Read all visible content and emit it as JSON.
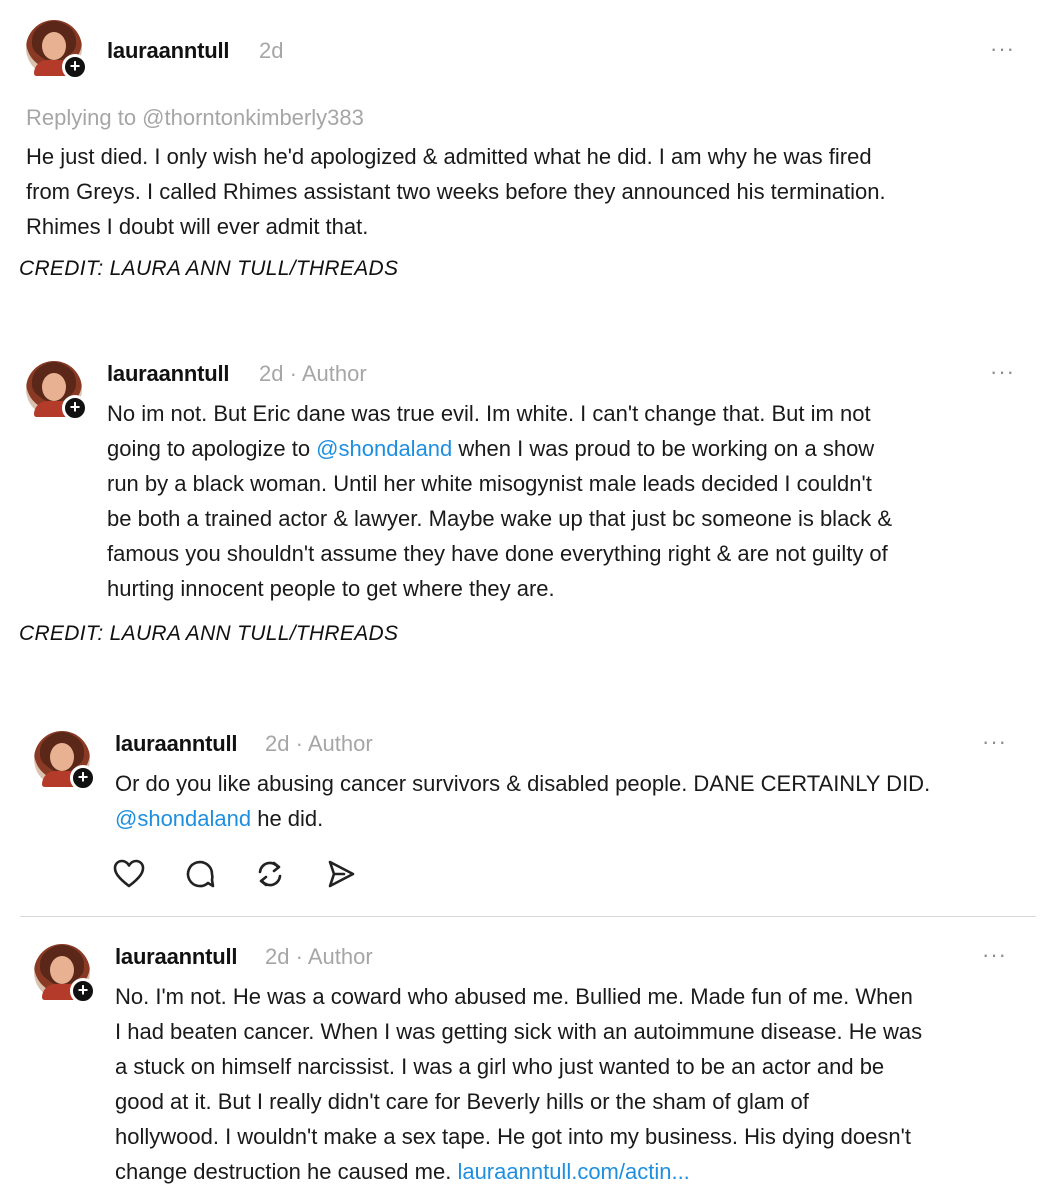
{
  "posts": [
    {
      "username": "lauraanntull",
      "time": "2d",
      "author_tag": "",
      "more": "···",
      "replying_to": "Replying to @thorntonkimberly383",
      "lines": [
        "He just died. I only wish he'd apologized & admitted what he did. I am why he was fired",
        "from Greys. I called Rhimes assistant two weeks before they announced his termination.",
        "Rhimes I doubt will ever admit that."
      ],
      "credit": "CREDIT: LAURA ANN TULL/THREADS"
    },
    {
      "username": "lauraanntull",
      "time": "2d",
      "author_tag": "· Author",
      "more": "···",
      "line1": "No im not. But Eric dane was true evil. Im white. I can't change that. But im not",
      "line2_pre": "going to apologize to ",
      "line2_mention": "@shondaland",
      "line2_post": " when I was proud to be working on a show",
      "lines_rest": [
        "run by a black woman. Until her white misogynist male leads decided I couldn't",
        "be both a trained actor & lawyer. Maybe wake up that just bc someone is black &",
        "famous you shouldn't assume they have done everything right & are not guilty of",
        "hurting innocent people to get where they are."
      ],
      "credit": "CREDIT: LAURA ANN TULL/THREADS"
    },
    {
      "username": "lauraanntull",
      "time": "2d",
      "author_tag": "· Author",
      "more": "···",
      "line1": "Or do you like abusing cancer survivors & disabled people. DANE CERTAINLY DID.",
      "line2_mention": "@shondaland",
      "line2_post": " he did.",
      "actions": [
        "heart-icon",
        "comment-icon",
        "repost-icon",
        "share-icon"
      ]
    },
    {
      "username": "lauraanntull",
      "time": "2d",
      "author_tag": "· Author",
      "more": "···",
      "lines": [
        "No. I'm not. He was a coward who abused me. Bullied me. Made fun of me. When",
        "I had beaten cancer. When I was getting sick with an autoimmune disease. He was",
        "a stuck on himself narcissist. I was a girl who just wanted to be an actor and be",
        "good at it. But I really didn't care for Beverly hills or the sham of glam of",
        "hollywood. I wouldn't make a sex tape. He got into my business. His dying doesn't"
      ],
      "last_pre": "change destruction he caused me. ",
      "last_link": "lauraanntull.com/actin..."
    }
  ],
  "colors": {
    "mention": "#1e8fe0",
    "meta": "#a6a6a6",
    "text": "#1a1a1a"
  }
}
